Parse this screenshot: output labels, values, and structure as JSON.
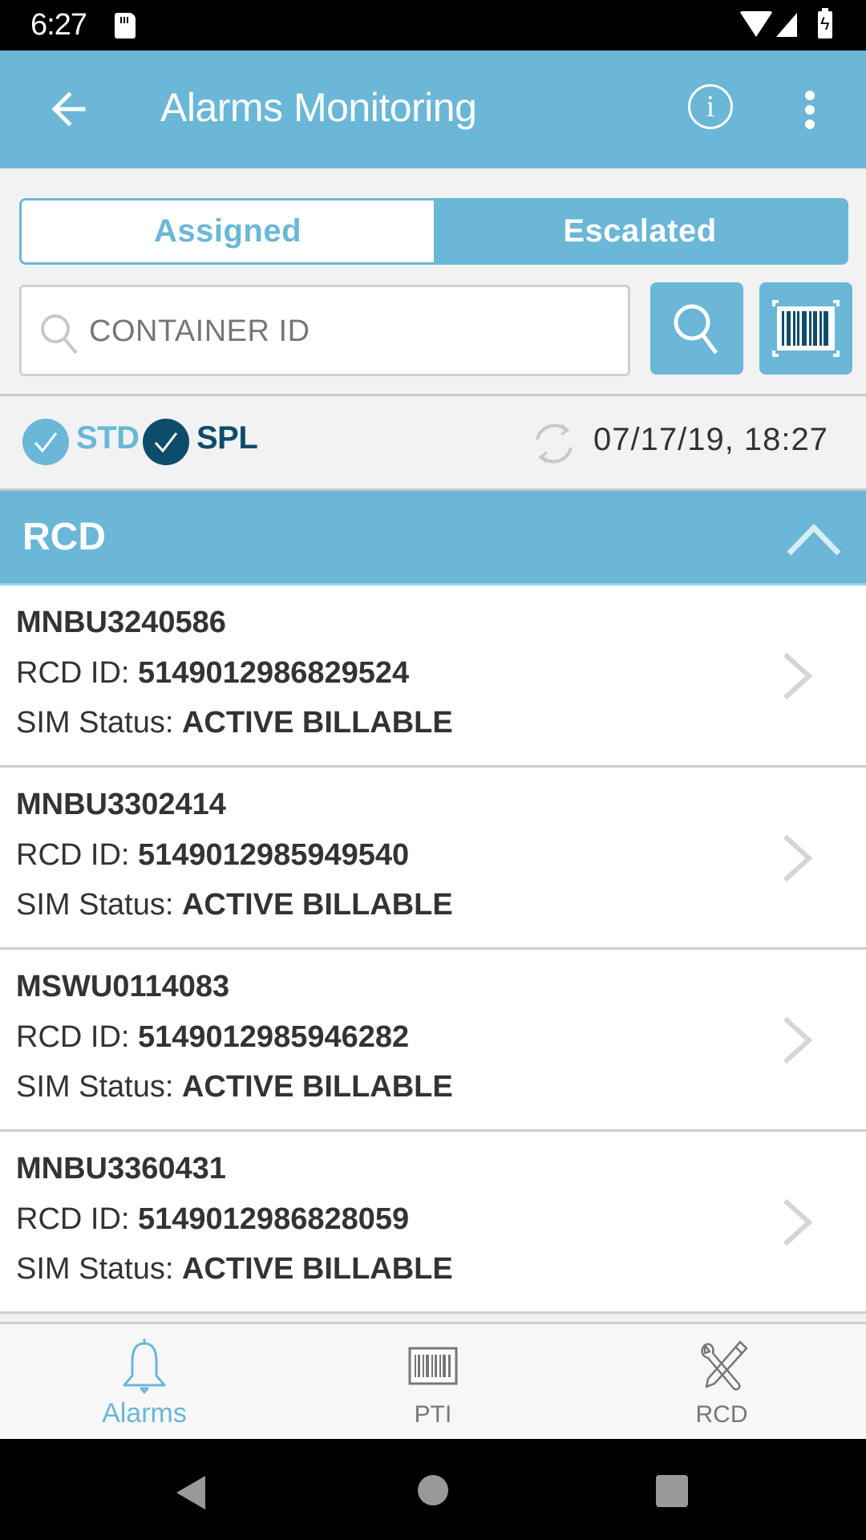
{
  "status_bar": {
    "time": "6:27",
    "icons": [
      "sd-card-icon",
      "wifi-icon",
      "cell-signal-icon",
      "battery-charging-icon"
    ]
  },
  "app_bar": {
    "title": "Alarms Monitoring",
    "back_icon": "arrow-left-icon",
    "info_icon": "info-icon",
    "info_glyph": "i",
    "more_icon": "more-vert-icon"
  },
  "segment": {
    "tabs": [
      {
        "label": "Assigned",
        "selected": true
      },
      {
        "label": "Escalated",
        "selected": false
      }
    ]
  },
  "search": {
    "placeholder": "CONTAINER ID",
    "value": "",
    "search_button_icon": "search-icon",
    "scan_button_icon": "barcode-scan-icon"
  },
  "filters": {
    "options": [
      {
        "label": "STD",
        "checked": true,
        "color": "#6ab7d7"
      },
      {
        "label": "SPL",
        "checked": true,
        "color": "#0d4d6b"
      }
    ],
    "refresh_icon": "refresh-icon",
    "last_updated": "07/17/19, 18:27"
  },
  "section": {
    "title": "RCD",
    "expanded": true
  },
  "labels": {
    "rcd_id": "RCD ID: ",
    "sim_status": "SIM Status: "
  },
  "items": [
    {
      "container_id": "MNBU3240586",
      "rcd_id": "5149012986829524",
      "sim_status": "ACTIVE BILLABLE"
    },
    {
      "container_id": "MNBU3302414",
      "rcd_id": "5149012985949540",
      "sim_status": "ACTIVE BILLABLE"
    },
    {
      "container_id": "MSWU0114083",
      "rcd_id": "5149012985946282",
      "sim_status": "ACTIVE BILLABLE"
    },
    {
      "container_id": "MNBU3360431",
      "rcd_id": "5149012986828059",
      "sim_status": "ACTIVE BILLABLE"
    }
  ],
  "bottom_nav": {
    "tabs": [
      {
        "label": "Alarms",
        "icon": "bell-icon",
        "active": true
      },
      {
        "label": "PTI",
        "icon": "barcode-icon",
        "active": false
      },
      {
        "label": "RCD",
        "icon": "tools-icon",
        "active": false
      }
    ]
  },
  "colors": {
    "primary": "#6ab7d7",
    "dark_accent": "#0d4d6b",
    "text": "#333333",
    "divider": "#cfcfcf"
  }
}
